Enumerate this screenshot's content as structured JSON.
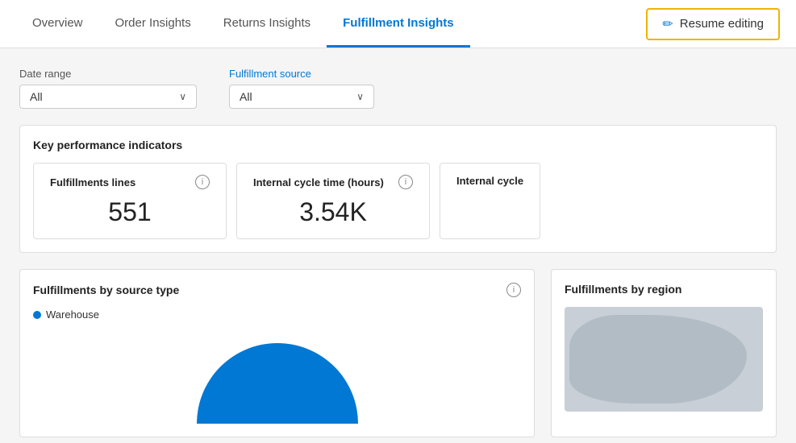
{
  "nav": {
    "items": [
      {
        "label": "Overview",
        "active": false
      },
      {
        "label": "Order Insights",
        "active": false
      },
      {
        "label": "Returns Insights",
        "active": false
      },
      {
        "label": "Fulfillment Insights",
        "active": true
      }
    ],
    "resume_editing_label": "Resume editing"
  },
  "filters": {
    "date_range": {
      "label": "Date range",
      "value": "All"
    },
    "fulfillment_source": {
      "label": "Fulfillment source",
      "label_color": "blue",
      "value": "All"
    }
  },
  "kpi_section": {
    "title": "Key performance indicators",
    "cards": [
      {
        "label": "Fulfillments lines",
        "value": "551"
      },
      {
        "label": "Internal cycle time (hours)",
        "value": "3.54K"
      },
      {
        "label": "Internal cycle",
        "value": ""
      }
    ]
  },
  "charts": {
    "left": {
      "title": "Fulfillments by source type",
      "legend": [
        {
          "label": "Warehouse",
          "color": "#0078d4"
        }
      ]
    },
    "right": {
      "title": "Fulfillments by region"
    }
  },
  "icons": {
    "chevron": "∨",
    "pencil": "✏",
    "info": "i"
  }
}
